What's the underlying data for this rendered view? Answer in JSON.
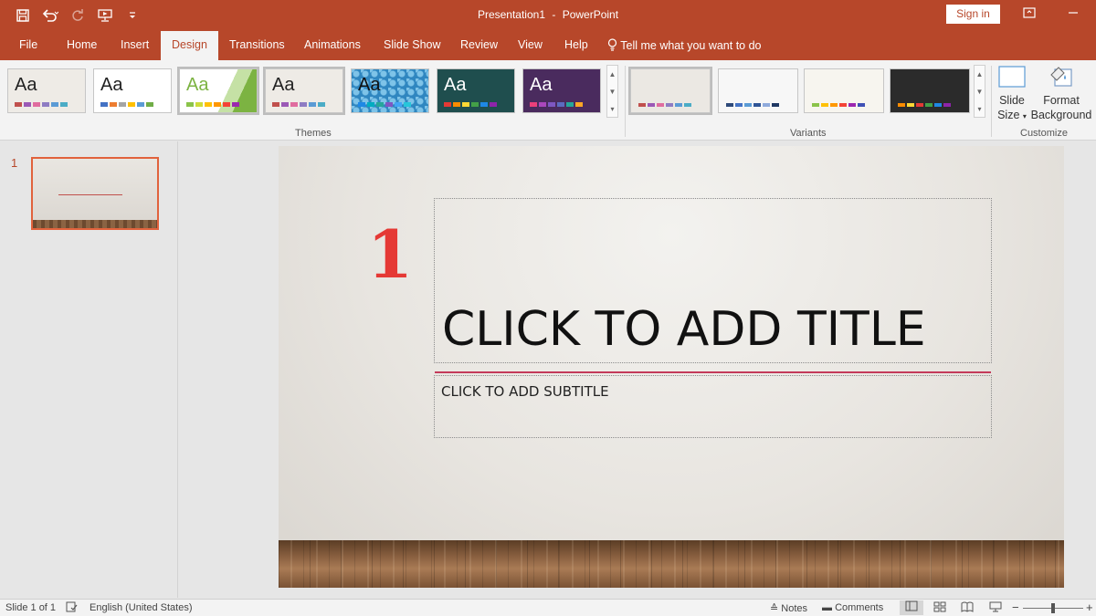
{
  "app": {
    "document_title": "Presentation1",
    "app_name": "PowerPoint",
    "title_separator": "-",
    "signin_label": "Sign in"
  },
  "qat": {
    "icons": [
      "save-icon",
      "undo-icon",
      "redo-icon",
      "present-from-start-icon",
      "customize-qat-icon"
    ]
  },
  "tabs": [
    {
      "label": "File"
    },
    {
      "label": "Home"
    },
    {
      "label": "Insert"
    },
    {
      "label": "Design",
      "active": true
    },
    {
      "label": "Transitions"
    },
    {
      "label": "Animations"
    },
    {
      "label": "Slide Show"
    },
    {
      "label": "Review"
    },
    {
      "label": "View"
    },
    {
      "label": "Help"
    }
  ],
  "tellme": "Tell me what you want to do",
  "ribbon": {
    "themes_label": "Themes",
    "variants_label": "Variants",
    "customize_label": "Customize",
    "theme_preview_text": "Aa",
    "slide_size": {
      "line1": "Slide",
      "line2": "Size"
    },
    "format_background": {
      "line1": "Format",
      "line2": "Background"
    },
    "themes": [
      {
        "bg": "#eeebe6",
        "text": "#222222",
        "colors": [
          "#c0504d",
          "#9b59b6",
          "#e06c9f",
          "#8e7cc3",
          "#5b9bd5",
          "#4bacc6"
        ]
      },
      {
        "bg": "#ffffff",
        "text": "#222222",
        "colors": [
          "#4472c4",
          "#ed7d31",
          "#a5a5a5",
          "#ffc000",
          "#5b9bd5",
          "#70ad47"
        ]
      },
      {
        "bg": "#ffffff",
        "text": "#7cb342",
        "colors": [
          "#8bc34a",
          "#cddc39",
          "#ffc107",
          "#ff9800",
          "#f44336",
          "#9c27b0"
        ]
      },
      {
        "bg": "#eeebe6",
        "text": "#222222",
        "colors": [
          "#c0504d",
          "#9b59b6",
          "#e06c9f",
          "#8e7cc3",
          "#5b9bd5",
          "#4bacc6"
        ]
      },
      {
        "bg": "#2f86c0",
        "text": "#111111",
        "colors": [
          "#1e88e5",
          "#00acc1",
          "#26a69a",
          "#7e57c2",
          "#42a5f5",
          "#26c6da"
        ]
      },
      {
        "bg": "#1f4e4e",
        "text": "#ffffff",
        "colors": [
          "#e53935",
          "#fb8c00",
          "#fdd835",
          "#43a047",
          "#1e88e5",
          "#8e24aa"
        ]
      },
      {
        "bg": "#4a2b5e",
        "text": "#ffffff",
        "colors": [
          "#ec407a",
          "#ab47bc",
          "#7e57c2",
          "#5c6bc0",
          "#26a69a",
          "#ffa726"
        ]
      }
    ],
    "variants": [
      {
        "bg": "#ebe8e3",
        "colors": [
          "#c0504d",
          "#9b59b6",
          "#e06c9f",
          "#8e7cc3",
          "#5b9bd5",
          "#4bacc6"
        ]
      },
      {
        "bg": "#f7f7f7",
        "colors": [
          "#2e4a7a",
          "#4472c4",
          "#5b9bd5",
          "#2f5597",
          "#8faadc",
          "#1f3864"
        ]
      },
      {
        "bg": "#f7f5ef",
        "colors": [
          "#8bc34a",
          "#ffc107",
          "#ff9800",
          "#f44336",
          "#9c27b0",
          "#3f51b5"
        ]
      },
      {
        "bg": "#2b2b2b",
        "colors": [
          "#fb8c00",
          "#fdd835",
          "#e53935",
          "#43a047",
          "#1e88e5",
          "#8e24aa"
        ]
      }
    ]
  },
  "thumbnail": {
    "number": "1"
  },
  "slide": {
    "big_number": "1",
    "title_placeholder": "CLICK TO ADD TITLE",
    "subtitle_placeholder": "CLICK TO ADD SUBTITLE"
  },
  "status": {
    "slide_info": "Slide 1 of 1",
    "language": "English (United States)",
    "notes_label": "Notes",
    "comments_label": "Comments",
    "zoom_level": 0.5
  },
  "colors": {
    "accent": "#b7472a",
    "big_number": "#e53935",
    "accent_line": "#c43a5a"
  }
}
